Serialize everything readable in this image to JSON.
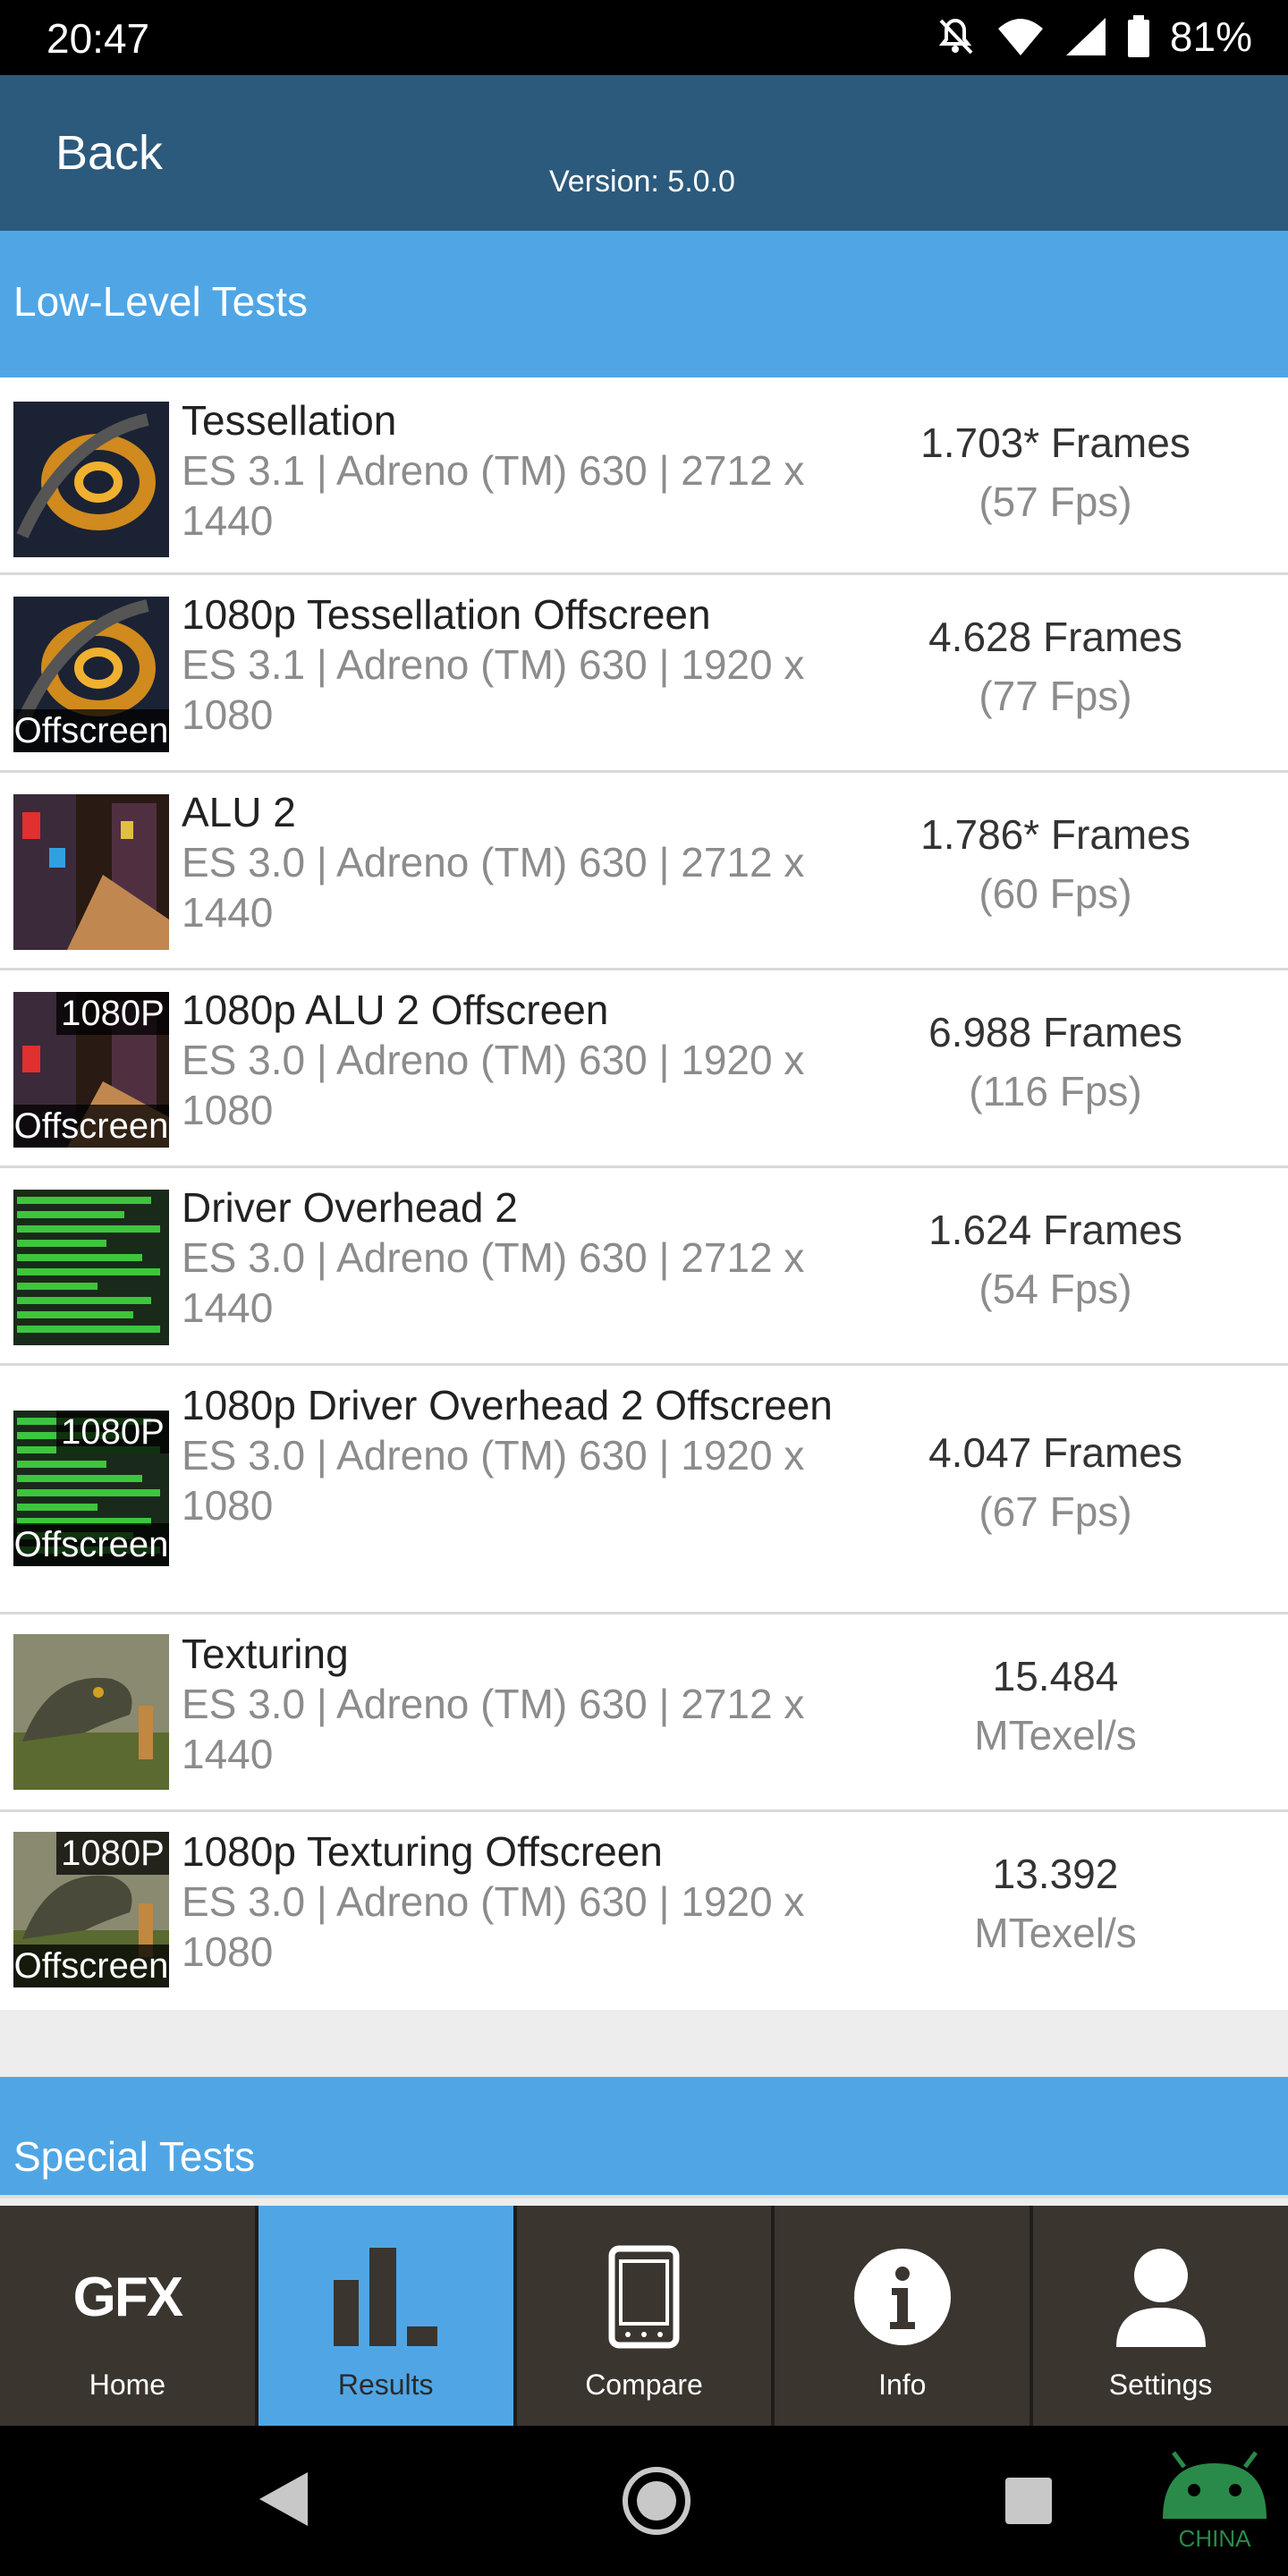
{
  "status_bar": {
    "time": "20:47",
    "battery": "81%",
    "icons": [
      "notifications-off-icon",
      "wifi-icon",
      "signal-icon",
      "battery-icon"
    ]
  },
  "app_bar": {
    "back_label": "Back",
    "version": "Version: 5.0.0"
  },
  "sections": {
    "low_level": "Low-Level Tests",
    "special": "Special Tests"
  },
  "tests": [
    {
      "name": "Tessellation",
      "details": "ES 3.1 | Adreno (TM) 630 | 2712 x 1440",
      "score": "1.703* Frames",
      "unit": "(57 Fps)",
      "badge_top": "",
      "badge_bottom": ""
    },
    {
      "name": "1080p Tessellation Offscreen",
      "details": "ES 3.1 | Adreno (TM) 630 | 1920 x 1080",
      "score": "4.628 Frames",
      "unit": "(77 Fps)",
      "badge_top": "",
      "badge_bottom": "Offscreen"
    },
    {
      "name": "ALU 2",
      "details": "ES 3.0 | Adreno (TM) 630 | 2712 x 1440",
      "score": "1.786* Frames",
      "unit": "(60 Fps)",
      "badge_top": "",
      "badge_bottom": ""
    },
    {
      "name": "1080p ALU 2 Offscreen",
      "details": "ES 3.0 | Adreno (TM) 630 | 1920 x 1080",
      "score": "6.988 Frames",
      "unit": "(116 Fps)",
      "badge_top": "1080P",
      "badge_bottom": "Offscreen"
    },
    {
      "name": "Driver Overhead 2",
      "details": "ES 3.0 | Adreno (TM) 630 | 2712 x 1440",
      "score": "1.624 Frames",
      "unit": "(54 Fps)",
      "badge_top": "",
      "badge_bottom": ""
    },
    {
      "name": "1080p Driver Overhead 2 Offscreen",
      "details": "ES 3.0 | Adreno (TM) 630 | 1920 x 1080",
      "score": "4.047 Frames",
      "unit": "(67 Fps)",
      "badge_top": "1080P",
      "badge_bottom": "Offscreen"
    },
    {
      "name": "Texturing",
      "details": "ES 3.0 | Adreno (TM) 630 | 2712 x 1440",
      "score": "15.484",
      "unit": "MTexel/s",
      "badge_top": "",
      "badge_bottom": ""
    },
    {
      "name": "1080p Texturing Offscreen",
      "details": "ES 3.0 | Adreno (TM) 630 | 1920 x 1080",
      "score": "13.392",
      "unit": "MTexel/s",
      "badge_top": "1080P",
      "badge_bottom": "Offscreen"
    }
  ],
  "bottom_nav": {
    "home_logo": "GFX",
    "home": "Home",
    "results": "Results",
    "compare": "Compare",
    "info": "Info",
    "settings": "Settings"
  },
  "watermark": "CHINA",
  "colors": {
    "app_bar": "#2c5a7d",
    "section_header": "#50a6e5",
    "nav_bg": "#3a352f",
    "nav_active": "#50a6e5"
  }
}
